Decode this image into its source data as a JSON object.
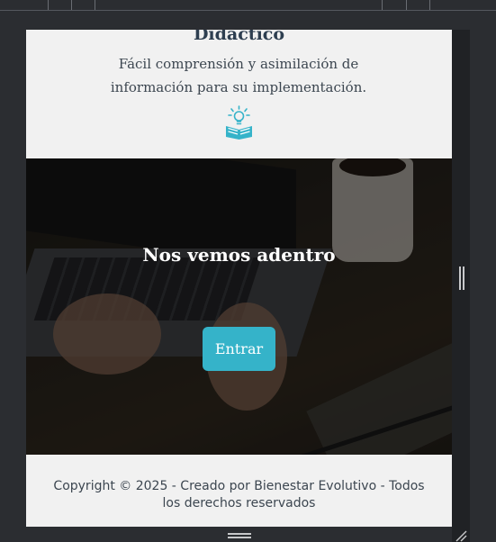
{
  "feature": {
    "title": "Didáctico",
    "description": "Fácil comprensión y asimilación de información para su implementación.",
    "icon": "book-lightbulb-icon",
    "accent_color": "#35b3c9"
  },
  "hero": {
    "title": "Nos vemos adentro",
    "button_label": "Entrar",
    "button_color": "#35b3c9"
  },
  "footer": {
    "copyright": "Copyright © 2025 - Creado por Bienestar Evolutivo - Todos los derechos reservados"
  }
}
